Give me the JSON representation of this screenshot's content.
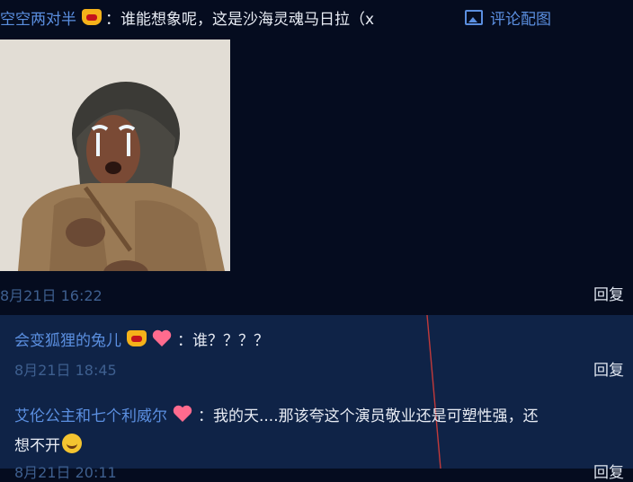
{
  "main_comment": {
    "username": "空空两对半",
    "text": "：谁能想象呢，这是沙海灵魂马日拉（x",
    "attachment_label": "评论配图",
    "timestamp": "8月21日 16:22",
    "reply_label": "回复"
  },
  "replies": [
    {
      "username": "会变狐狸的兔儿",
      "text": "：谁？？？？",
      "timestamp": "8月21日 18:45",
      "reply_label": "回复"
    },
    {
      "username": "艾伦公主和七个利威尔",
      "text": "：我的天....那该夸这个演员敬业还是可塑性强，还",
      "text_line2": "想不开",
      "timestamp": "8月21日 20:11",
      "reply_label": "回复"
    }
  ],
  "colors": {
    "background": "#050c1f",
    "reply_panel": "#0f2347",
    "username": "#5b8fe0",
    "timestamp": "#3e5f8f"
  },
  "icons": [
    "crown-badge-icon",
    "image-icon",
    "heart-icon",
    "laughing-crying-emoji-icon"
  ]
}
